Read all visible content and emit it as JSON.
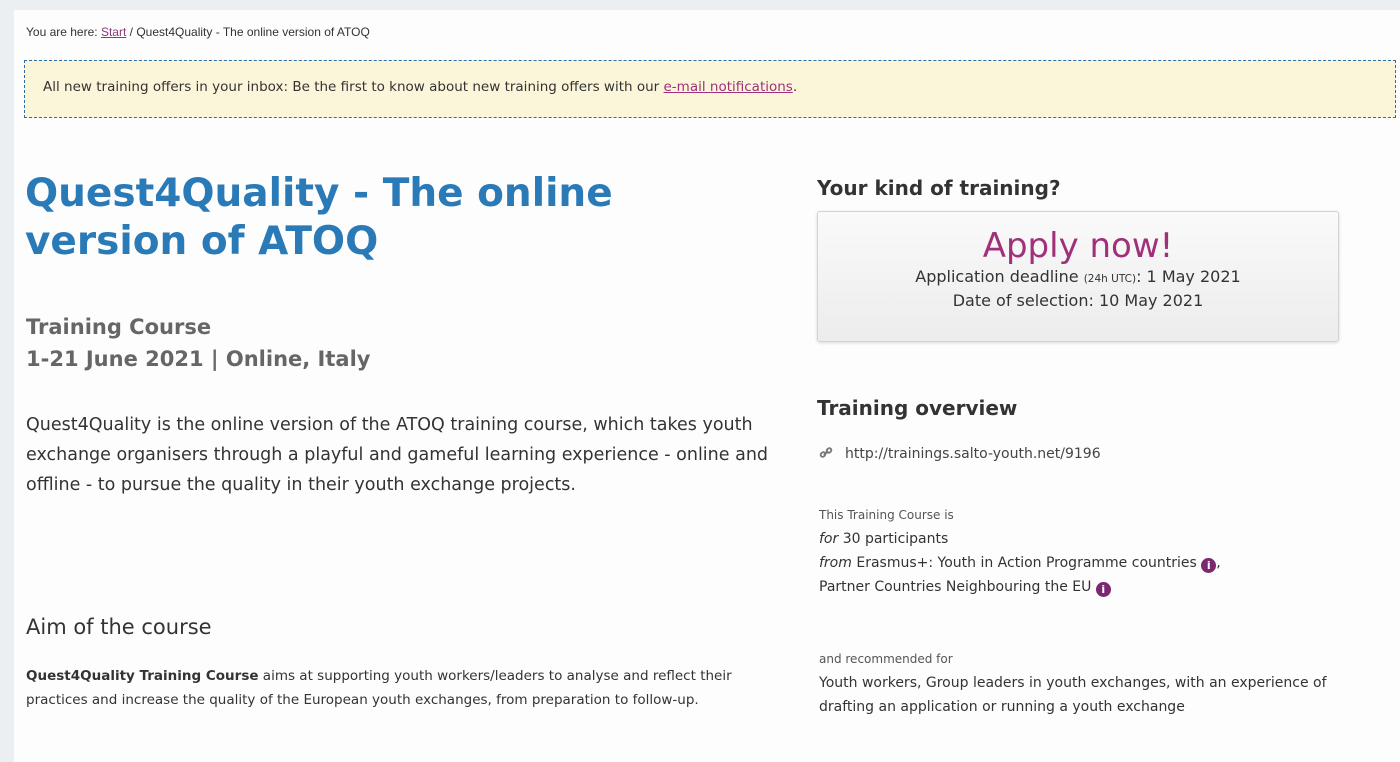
{
  "breadcrumb": {
    "prefix": "You are here:",
    "start": "Start",
    "separator": "/",
    "current": "Quest4Quality - The online version of ATOQ"
  },
  "notice": {
    "text": "All new training offers in your inbox: Be the first to know about new training offers with our",
    "link": "e-mail notifications",
    "end": "."
  },
  "main": {
    "title": "Quest4Quality - The online version of ATOQ",
    "type": "Training Course",
    "dates_location": "1-21 June 2021 | Online, Italy",
    "description": "Quest4Quality is the online version of the ATOQ training course, which takes youth exchange organisers through a playful and gameful learning experience - online and offline - to pursue the quality in their youth exchange projects.",
    "aim_heading": "Aim of the course",
    "aim_bold": "Quest4Quality Training Course",
    "aim_text": " aims at supporting youth workers/leaders to analyse and reflect their practices and increase the quality of the European youth exchanges, from preparation to follow-up."
  },
  "sidebar": {
    "kind_heading": "Your kind of training?",
    "apply": {
      "title": "Apply now!",
      "deadline_label": "Application deadline",
      "deadline_note": "(24h UTC)",
      "deadline_value": ": 1 May 2021",
      "selection": "Date of selection: 10 May 2021"
    },
    "overview_heading": "Training overview",
    "url": "http://trainings.salto-youth.net/9196",
    "icon_link": "link-icon",
    "this_is": "This Training Course is",
    "for_label": "for",
    "participants": "30 participants",
    "from_label": "from",
    "from_value_1": "Erasmus+: Youth in Action Programme countries",
    "from_value_2": "Partner Countries Neighbouring the EU",
    "info_icon_glyph": "i",
    "recommended_label": "and recommended for",
    "recommended_text": "Youth workers, Group leaders in youth exchanges, with an experience of drafting an application or running a youth exchange"
  },
  "colors": {
    "title_blue": "#2a7ab8",
    "accent_purple": "#a0307a",
    "notice_bg": "#fbf6d9"
  }
}
